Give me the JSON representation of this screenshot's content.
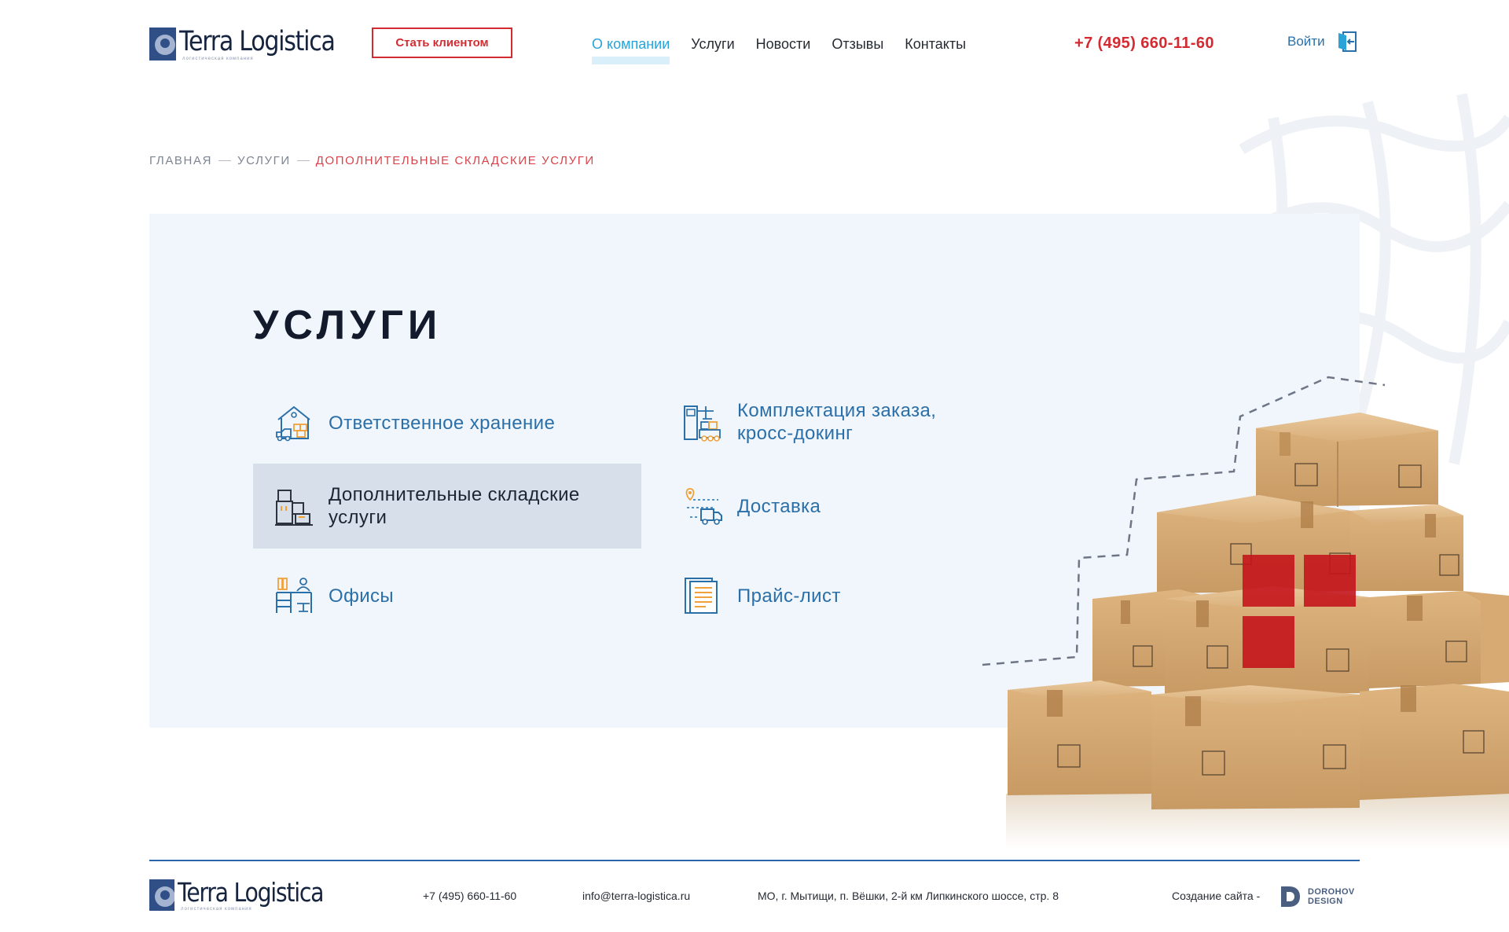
{
  "header": {
    "logo_title": "Terra Logistica",
    "logo_subtitle": "логистическая компания",
    "cta_label": "Стать клиентом",
    "nav": [
      {
        "label": "О компании",
        "active": true
      },
      {
        "label": "Услуги",
        "active": false
      },
      {
        "label": "Новости",
        "active": false
      },
      {
        "label": "Отзывы",
        "active": false
      },
      {
        "label": "Контакты",
        "active": false
      }
    ],
    "phone": "+7 (495) 660-11-60",
    "login_label": "Войти",
    "login_icon": "login-door-icon"
  },
  "breadcrumb": {
    "items": [
      "ГЛАВНАЯ",
      "УСЛУГИ",
      "ДОПОЛНИТЕЛЬНЫЕ СКЛАДСКИЕ УСЛУГИ"
    ]
  },
  "services": {
    "title": "УСЛУГИ",
    "items": [
      {
        "label": "Ответственное хранение",
        "icon": "warehouse-storage-icon",
        "active": false
      },
      {
        "label": "Дополнительные складские услуги",
        "icon": "stacked-boxes-icon",
        "active": true
      },
      {
        "label": "Офисы",
        "icon": "office-desk-icon",
        "active": false
      },
      {
        "label": "Комплектация заказа, кросс-докинг",
        "icon": "order-picking-icon",
        "active": false
      },
      {
        "label": "Доставка",
        "icon": "delivery-truck-icon",
        "active": false
      },
      {
        "label": "Прайс-лист",
        "icon": "price-list-icon",
        "active": false
      }
    ]
  },
  "footer": {
    "logo_title": "Terra Logistica",
    "logo_subtitle": "логистическая компания",
    "phone": "+7 (495) 660-11-60",
    "email": "info@terra-logistica.ru",
    "address": "МО, г. Мытищи, п. Вёшки, 2-й км Липкинского шоссе, стр. 8",
    "credit": "Создание сайта -",
    "studio_line1": "DOROHOV",
    "studio_line2": "DESIGN"
  },
  "colors": {
    "accent_red": "#d22b31",
    "link_blue": "#2b6fa8",
    "nav_active": "#2aa3d9",
    "panel_bg": "#f1f6fd",
    "active_item_bg": "#d6dfea",
    "box_marker_red": "#c4151c"
  }
}
